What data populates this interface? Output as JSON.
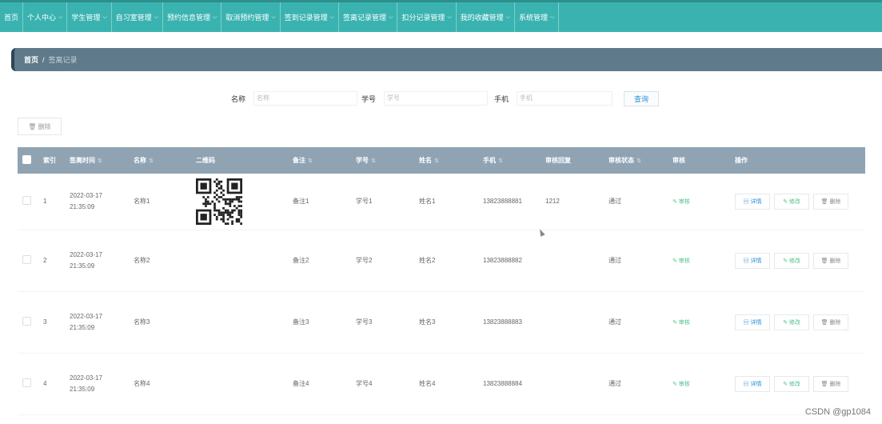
{
  "nav": {
    "items": [
      {
        "label": "首页",
        "chevron": false
      },
      {
        "label": "个人中心",
        "chevron": true
      },
      {
        "label": "学生管理",
        "chevron": true
      },
      {
        "label": "自习室管理",
        "chevron": true
      },
      {
        "label": "预约信息管理",
        "chevron": true
      },
      {
        "label": "取消预约管理",
        "chevron": true
      },
      {
        "label": "签到记录管理",
        "chevron": true
      },
      {
        "label": "签离记录管理",
        "chevron": true
      },
      {
        "label": "扣分记录管理",
        "chevron": true
      },
      {
        "label": "我的收藏管理",
        "chevron": true
      },
      {
        "label": "系统管理",
        "chevron": true
      }
    ],
    "chevron_glyph": "⌵"
  },
  "breadcrumb": {
    "home": "首页",
    "separator": "/",
    "current": "签离记录"
  },
  "search": {
    "name_label": "名称",
    "name_placeholder": "名称",
    "student_id_label": "学号",
    "student_id_placeholder": "学号",
    "phone_label": "手机",
    "phone_placeholder": "手机",
    "button": "查询"
  },
  "toolbar": {
    "delete_label": "🗑 删除"
  },
  "table": {
    "headers": [
      "索引",
      "签离时间",
      "名称",
      "二维码",
      "备注",
      "学号",
      "姓名",
      "手机",
      "审核回复",
      "审核状态",
      "审核",
      "操作"
    ],
    "sort_glyph": "⇅",
    "rows": [
      {
        "index": "1",
        "time": "2022-03-17 21:35:09",
        "name": "名称1",
        "qr": true,
        "note": "备注1",
        "student_id": "学号1",
        "student_name": "姓名1",
        "phone": "13823888881",
        "reply": "1212",
        "status": "通过",
        "audit": "✎ 审核"
      },
      {
        "index": "2",
        "time": "2022-03-17 21:35:09",
        "name": "名称2",
        "qr": false,
        "note": "备注2",
        "student_id": "学号2",
        "student_name": "姓名2",
        "phone": "13823888882",
        "reply": "",
        "status": "通过",
        "audit": "✎ 审核"
      },
      {
        "index": "3",
        "time": "2022-03-17 21:35:09",
        "name": "名称3",
        "qr": false,
        "note": "备注3",
        "student_id": "学号3",
        "student_name": "姓名3",
        "phone": "13823888883",
        "reply": "",
        "status": "通过",
        "audit": "✎ 审核"
      },
      {
        "index": "4",
        "time": "2022-03-17 21:35:09",
        "name": "名称4",
        "qr": false,
        "note": "备注4",
        "student_id": "学号4",
        "student_name": "姓名4",
        "phone": "13823888884",
        "reply": "",
        "status": "通过",
        "audit": "✎ 审核"
      }
    ],
    "actions": {
      "detail": "▤ 详情",
      "edit": "✎ 修改",
      "remove": "🗑 删除"
    }
  },
  "watermark": "CSDN @gp1084",
  "colors": {
    "nav_bg": "#3ab3b0",
    "crumb_bg": "#5f7a8a",
    "header_bg": "#8fa3b3",
    "link_blue": "#2a8fd6",
    "green": "#4cbf8a"
  }
}
